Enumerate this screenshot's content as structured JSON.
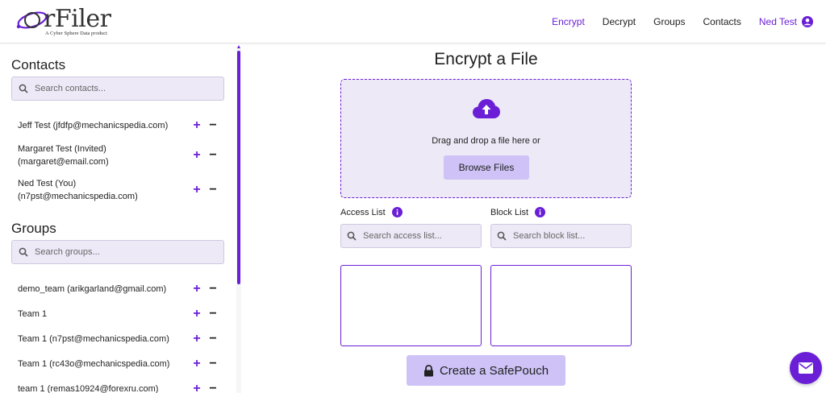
{
  "brand": {
    "name": "rFiler",
    "tagline": "A Cyber Sphere Data product",
    "accent": "#6a1fd6",
    "soft": "#ede9f7",
    "button": "#cec2f6"
  },
  "nav": {
    "items": [
      {
        "label": "Encrypt",
        "active": true
      },
      {
        "label": "Decrypt",
        "active": false
      },
      {
        "label": "Groups",
        "active": false
      },
      {
        "label": "Contacts",
        "active": false
      }
    ],
    "user": {
      "label": "Ned Test",
      "icon": "user-circle-icon"
    }
  },
  "sidebar": {
    "contacts": {
      "title": "Contacts",
      "search_placeholder": "Search contacts...",
      "items": [
        {
          "label": "Jeff Test (jfdfp@mechanicspedia.com)"
        },
        {
          "label": "Margaret Test (Invited) (margaret@email.com)"
        },
        {
          "label": "Ned Test (You) (n7pst@mechanicspedia.com)"
        }
      ]
    },
    "groups": {
      "title": "Groups",
      "search_placeholder": "Search groups...",
      "items": [
        {
          "label": "demo_team (arikgarland@gmail.com)"
        },
        {
          "label": "Team 1"
        },
        {
          "label": "Team 1 (n7pst@mechanicspedia.com)"
        },
        {
          "label": "Team 1 (rc43o@mechanicspedia.com)"
        },
        {
          "label": "team 1 (remas10924@forexru.com)"
        }
      ]
    },
    "add_symbol": "+",
    "remove_symbol": "−"
  },
  "main": {
    "title": "Encrypt a File",
    "dropzone": {
      "icon": "cloud-upload-icon",
      "text": "Drag and drop a file here or",
      "browse_label": "Browse Files"
    },
    "access_list": {
      "label": "Access List",
      "search_placeholder": "Search access list..."
    },
    "block_list": {
      "label": "Block List",
      "search_placeholder": "Search block list..."
    },
    "create_label": "Create a SafePouch"
  },
  "fab": {
    "icon": "mail-icon"
  }
}
